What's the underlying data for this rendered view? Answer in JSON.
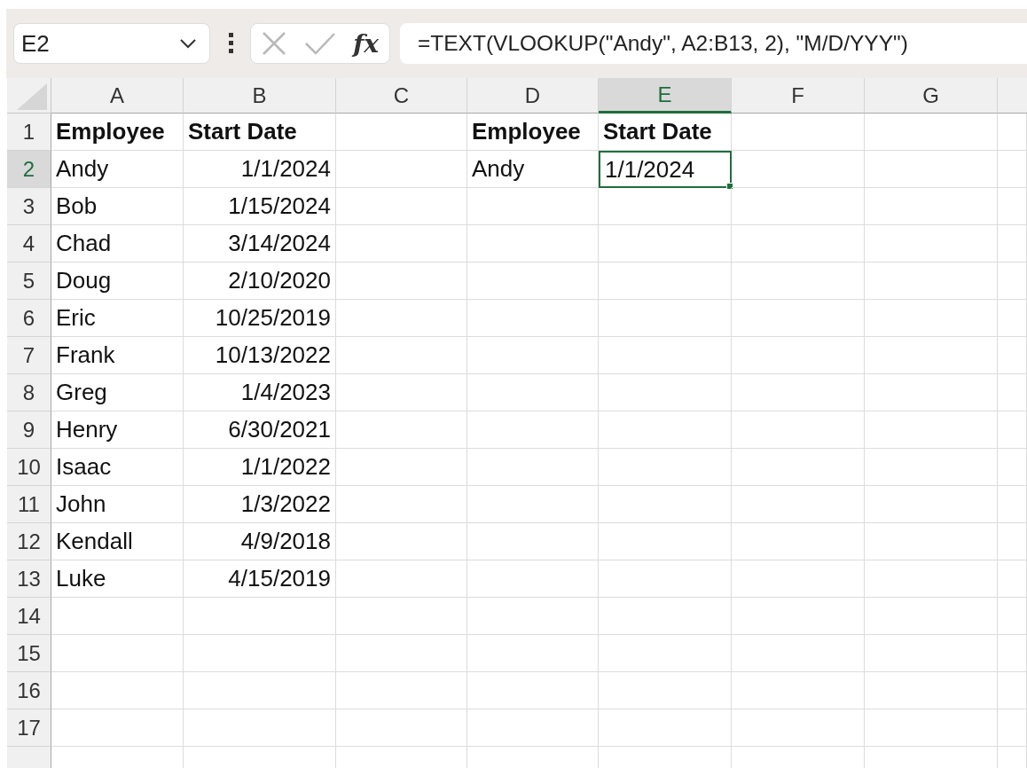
{
  "formula_bar": {
    "name_box": "E2",
    "function_button": "fx",
    "formula": "=TEXT(VLOOKUP(\"Andy\", A2:B13, 2), \"M/D/YYY\")"
  },
  "columns": [
    {
      "label": "A",
      "selected": false
    },
    {
      "label": "B",
      "selected": false
    },
    {
      "label": "C",
      "selected": false
    },
    {
      "label": "D",
      "selected": false
    },
    {
      "label": "E",
      "selected": true
    },
    {
      "label": "F",
      "selected": false
    },
    {
      "label": "G",
      "selected": false
    }
  ],
  "rows": [
    {
      "label": "1",
      "selected": false,
      "cells": [
        {
          "text": "Employee",
          "kind": "header"
        },
        {
          "text": "Start Date",
          "kind": "header"
        },
        null,
        {
          "text": "Employee",
          "kind": "header"
        },
        {
          "text": "Start Date",
          "kind": "header"
        },
        null,
        null
      ]
    },
    {
      "label": "2",
      "selected": true,
      "cells": [
        {
          "text": "Andy",
          "kind": "text"
        },
        {
          "text": "1/1/2024",
          "kind": "date"
        },
        null,
        {
          "text": "Andy",
          "kind": "text"
        },
        {
          "text": "1/1/2024",
          "kind": "text"
        },
        null,
        null
      ]
    },
    {
      "label": "3",
      "selected": false,
      "cells": [
        {
          "text": "Bob",
          "kind": "text"
        },
        {
          "text": "1/15/2024",
          "kind": "date"
        },
        null,
        null,
        null,
        null,
        null
      ]
    },
    {
      "label": "4",
      "selected": false,
      "cells": [
        {
          "text": "Chad",
          "kind": "text"
        },
        {
          "text": "3/14/2024",
          "kind": "date"
        },
        null,
        null,
        null,
        null,
        null
      ]
    },
    {
      "label": "5",
      "selected": false,
      "cells": [
        {
          "text": "Doug",
          "kind": "text"
        },
        {
          "text": "2/10/2020",
          "kind": "date"
        },
        null,
        null,
        null,
        null,
        null
      ]
    },
    {
      "label": "6",
      "selected": false,
      "cells": [
        {
          "text": "Eric",
          "kind": "text"
        },
        {
          "text": "10/25/2019",
          "kind": "date"
        },
        null,
        null,
        null,
        null,
        null
      ]
    },
    {
      "label": "7",
      "selected": false,
      "cells": [
        {
          "text": "Frank",
          "kind": "text"
        },
        {
          "text": "10/13/2022",
          "kind": "date"
        },
        null,
        null,
        null,
        null,
        null
      ]
    },
    {
      "label": "8",
      "selected": false,
      "cells": [
        {
          "text": "Greg",
          "kind": "text"
        },
        {
          "text": "1/4/2023",
          "kind": "date"
        },
        null,
        null,
        null,
        null,
        null
      ]
    },
    {
      "label": "9",
      "selected": false,
      "cells": [
        {
          "text": "Henry",
          "kind": "text"
        },
        {
          "text": "6/30/2021",
          "kind": "date"
        },
        null,
        null,
        null,
        null,
        null
      ]
    },
    {
      "label": "10",
      "selected": false,
      "cells": [
        {
          "text": "Isaac",
          "kind": "text"
        },
        {
          "text": "1/1/2022",
          "kind": "date"
        },
        null,
        null,
        null,
        null,
        null
      ]
    },
    {
      "label": "11",
      "selected": false,
      "cells": [
        {
          "text": "John",
          "kind": "text"
        },
        {
          "text": "1/3/2022",
          "kind": "date"
        },
        null,
        null,
        null,
        null,
        null
      ]
    },
    {
      "label": "12",
      "selected": false,
      "cells": [
        {
          "text": "Kendall",
          "kind": "text"
        },
        {
          "text": "4/9/2018",
          "kind": "date"
        },
        null,
        null,
        null,
        null,
        null
      ]
    },
    {
      "label": "13",
      "selected": false,
      "cells": [
        {
          "text": "Luke",
          "kind": "text"
        },
        {
          "text": "4/15/2019",
          "kind": "date"
        },
        null,
        null,
        null,
        null,
        null
      ]
    },
    {
      "label": "14",
      "selected": false,
      "cells": [
        null,
        null,
        null,
        null,
        null,
        null,
        null
      ]
    },
    {
      "label": "15",
      "selected": false,
      "cells": [
        null,
        null,
        null,
        null,
        null,
        null,
        null
      ]
    },
    {
      "label": "16",
      "selected": false,
      "cells": [
        null,
        null,
        null,
        null,
        null,
        null,
        null
      ]
    },
    {
      "label": "17",
      "selected": false,
      "cells": [
        null,
        null,
        null,
        null,
        null,
        null,
        null
      ]
    }
  ]
}
